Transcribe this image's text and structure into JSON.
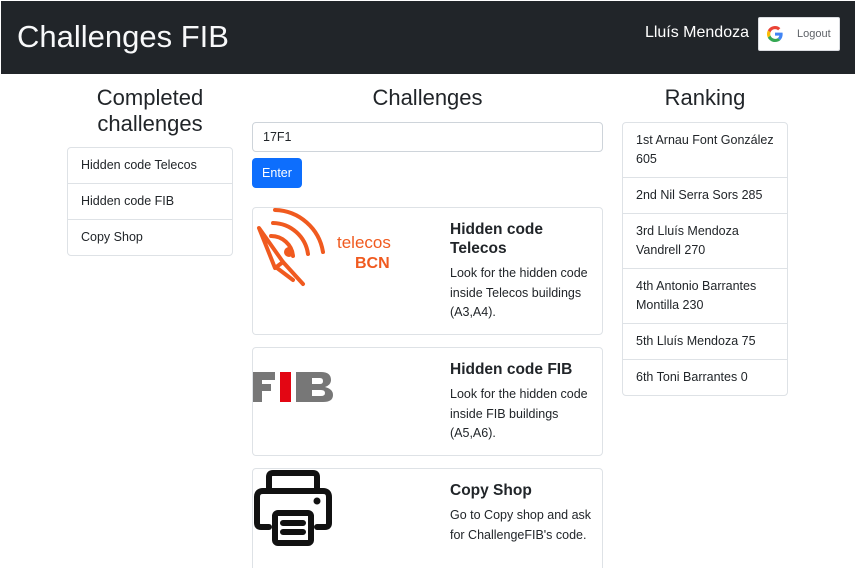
{
  "navbar": {
    "brand": "Challenges FIB",
    "user_name": "Lluís Mendoza",
    "logout_label": "Logout"
  },
  "completed": {
    "title": "Completed challenges",
    "items": [
      "Hidden code Telecos",
      "Hidden code FIB",
      "Copy Shop"
    ]
  },
  "challenges": {
    "title": "Challenges",
    "code_input_value": "17F1",
    "enter_label": "Enter",
    "cards": [
      {
        "title": "Hidden code Telecos",
        "text": "Look for the hidden code inside Telecos buildings (A3,A4).",
        "image": "telecos-bcn-logo",
        "logo_text_top": "telecos",
        "logo_text_bottom": "BCN"
      },
      {
        "title": "Hidden code FIB",
        "text": "Look for the hidden code inside FIB buildings (A5,A6).",
        "image": "fib-logo",
        "logo_text": "FIB"
      },
      {
        "title": "Copy Shop",
        "text": "Go to Copy shop and ask for ChallengeFIB's code.",
        "image": "printer-icon"
      }
    ]
  },
  "ranking": {
    "title": "Ranking",
    "items": [
      "1st Arnau Font González 605",
      "2nd Nil Serra Sors 285",
      "3rd Lluís Mendoza Vandrell 270",
      "4th Antonio Barrantes Montilla 230",
      "5th Lluís Mendoza 75",
      "6th Toni Barrantes 0"
    ]
  },
  "colors": {
    "navbar_bg": "#212529",
    "primary": "#0d6efd",
    "telecos_orange": "#f05a1f",
    "fib_red": "#e30613",
    "fib_gray": "#777777"
  }
}
